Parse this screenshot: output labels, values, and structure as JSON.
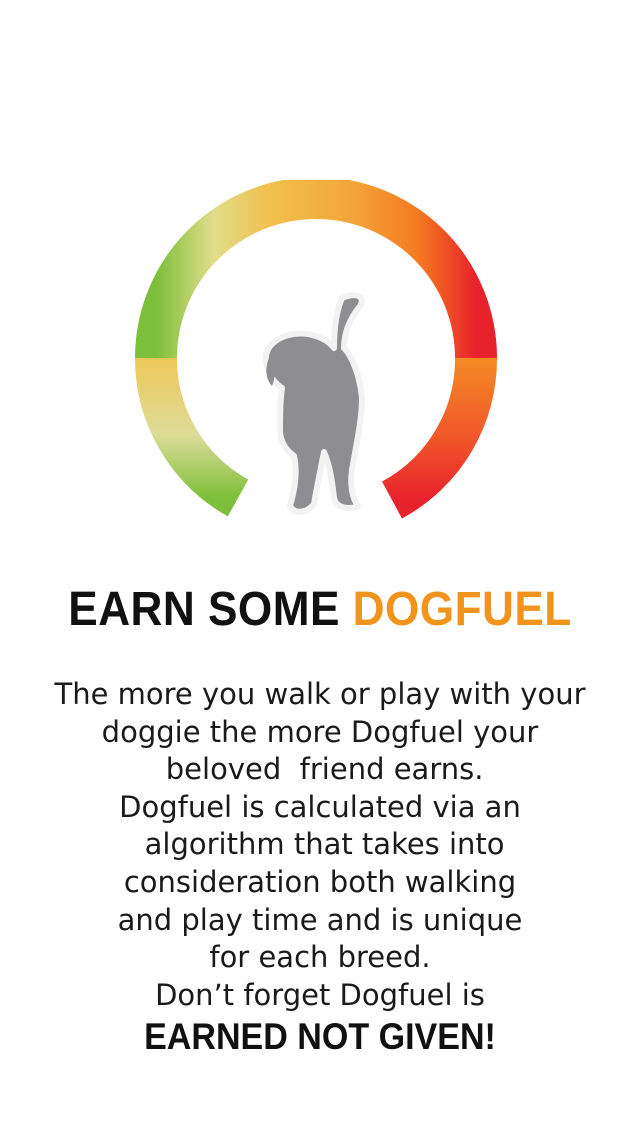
{
  "gauge": {
    "icon": "dog-silhouette-icon",
    "colors": {
      "low": "#7dbf3a",
      "mid_low": "#e8c65a",
      "mid": "#f4a73a",
      "high": "#f47a20",
      "max": "#e8222b",
      "dog": "#8e8e92"
    }
  },
  "headline": {
    "part1": "EARN SOME",
    "part2": "DOGFUEL",
    "accent_color": "#f0941e"
  },
  "description": {
    "lines": [
      "The more you walk or play with your",
      "doggie the more Dogfuel your",
      " beloved  friend earns.",
      "Dogfuel is calculated via an",
      " algorithm that takes into",
      "consideration both walking",
      "and play time and is unique",
      "for each breed.",
      "Don’t forget Dogfuel is"
    ]
  },
  "closing": {
    "text": "EARNED NOT GIVEN!"
  }
}
